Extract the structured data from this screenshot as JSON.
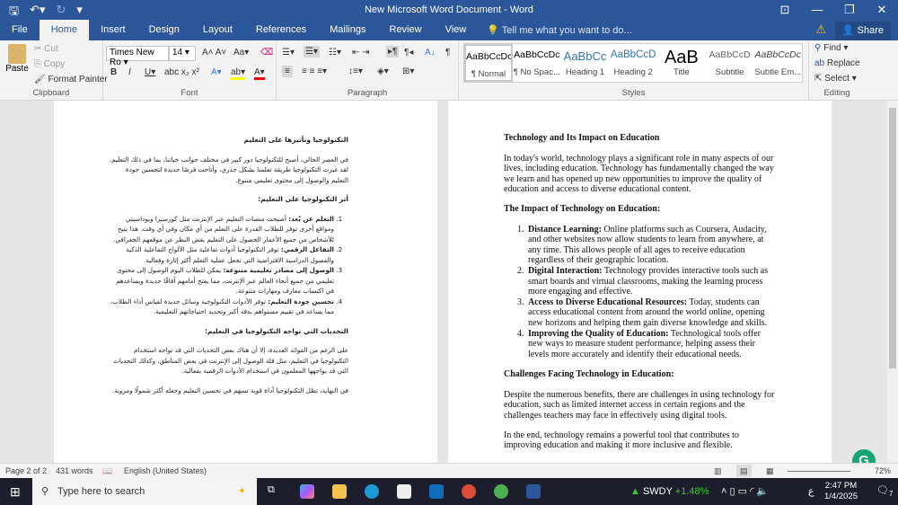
{
  "title": "New Microsoft Word Document - Word",
  "tabs": [
    "File",
    "Home",
    "Insert",
    "Design",
    "Layout",
    "References",
    "Mailings",
    "Review",
    "View"
  ],
  "tell_me": "Tell me what you want to do...",
  "share": "Share",
  "clipboard": {
    "paste": "Paste",
    "cut": "Cut",
    "copy": "Copy",
    "format_painter": "Format Painter",
    "label": "Clipboard"
  },
  "font": {
    "name": "Times New Ro",
    "size": "14",
    "label": "Font"
  },
  "paragraph": {
    "label": "Paragraph"
  },
  "styles": {
    "label": "Styles",
    "items": [
      {
        "preview": "AaBbCcDc",
        "name": "¶ Normal"
      },
      {
        "preview": "AaBbCcDc",
        "name": "¶ No Spac..."
      },
      {
        "preview": "AaBbCc",
        "name": "Heading 1"
      },
      {
        "preview": "AaBbCcD",
        "name": "Heading 2"
      },
      {
        "preview": "AaB",
        "name": "Title"
      },
      {
        "preview": "AaBbCcD",
        "name": "Subtitle"
      },
      {
        "preview": "AaBbCcDc",
        "name": "Subtle Em..."
      }
    ]
  },
  "editing": {
    "find": "Find",
    "replace": "Replace",
    "select": "Select",
    "label": "Editing"
  },
  "arabic": {
    "title": "التكنولوجيا وتأثيرها على التعليم",
    "intro": "في العصر الحالي، أصبح للتكنولوجيا دور كبير في مختلف جوانب حياتنا، بما في ذلك التعليم. لقد غيرت التكنولوجيا طريقة تعلمنا بشكل جذري، وأتاحت فرصًا جديدة لتحسين جودة التعليم والوصول إلى محتوى تعليمي متنوع.",
    "impact_heading": "أثر التكنولوجيا على التعليم:",
    "items": [
      {
        "b": "التعلم عن بُعد:",
        "t": " أصبحت منصات التعليم عبر الإنترنت مثل كورسيرا ويوداسيتي ومواقع أخرى توفر للطلاب القدرة على التعلم من أي مكان وفي أي وقت. هذا يتيح للأشخاص من جميع الأعمار الحصول على التعليم بغض النظر عن موقعهم الجغرافي."
      },
      {
        "b": "التفاعل الرقمي:",
        "t": " توفر التكنولوجيا أدوات تفاعلية مثل الألواح التفاعلية الذكية والفصول الدراسية الافتراضية التي تجعل عملية التعلم أكثر إثارة وفعالية."
      },
      {
        "b": "الوصول إلى مصادر تعليمية متنوعة:",
        "t": " يمكن للطلاب اليوم الوصول إلى محتوى تعليمي من جميع أنحاء العالم عبر الإنترنت، مما يفتح أمامهم آفاقًا جديدة ويساعدهم في اكتساب معارف ومهارات متنوعة."
      },
      {
        "b": "تحسين جودة التعليم:",
        "t": " توفر الأدوات التكنولوجية وسائل جديدة لقياس أداء الطلاب، مما يساعد في تقييم مستواهم بدقة أكبر وتحديد احتياجاتهم التعليمية."
      }
    ],
    "challenges_heading": "التحديات التي تواجه التكنولوجيا في التعليم:",
    "challenges": "على الرغم من الفوائد العديدة، إلا أن هناك بعض التحديات التي قد تواجه استخدام التكنولوجيا في التعليم، مثل قلة الوصول إلى الإنترنت في بعض المناطق، وكذلك التحديات التي قد يواجهها المعلمون في استخدام الأدوات الرقمية بفعالية.",
    "conclusion": "في النهاية، تظل التكنولوجيا أداة قوية تسهم في تحسين التعليم وجعله أكثر شمولًا ومرونة."
  },
  "english": {
    "title": "Technology and Its Impact on Education",
    "intro": "In today's world, technology plays a significant role in many aspects of our lives, including education. Technology has fundamentally changed the way we learn and has opened up new opportunities to improve the quality of education and access to diverse educational content.",
    "impact_heading": "The Impact of Technology on Education:",
    "items": [
      {
        "b": "Distance Learning:",
        "t": " Online platforms such as Coursera, Audacity, and other websites now allow students to learn from anywhere, at any time. This allows people of all ages to receive education regardless of their geographic location."
      },
      {
        "b": "Digital Interaction:",
        "t": " Technology provides interactive tools such as smart boards and virtual classrooms, making the learning process more engaging and effective."
      },
      {
        "b": "Access to Diverse Educational Resources:",
        "t": " Today, students can access educational content from around the world online, opening new horizons and helping them gain diverse knowledge and skills."
      },
      {
        "b": "Improving the Quality of Education:",
        "t": " Technological tools offer new ways to measure student performance, helping assess their levels more accurately and identify their educational needs."
      }
    ],
    "challenges_heading": "Challenges Facing Technology in Education:",
    "challenges": "Despite the numerous benefits, there are challenges in using technology for education, such as limited internet access in certain regions and the challenges teachers may face in effectively using digital tools.",
    "conclusion": "In the end, technology remains a powerful tool that contributes to improving education and making it more inclusive and flexible."
  },
  "status": {
    "page": "Page 2 of 2",
    "words": "431 words",
    "language": "English (United States)",
    "zoom": "72%"
  },
  "taskbar": {
    "search": "Type here to search",
    "stock_name": "SWDY",
    "stock_change": "+1.48%",
    "time": "2:47 PM",
    "date": "1/4/2025",
    "lang": "ع",
    "notif": "7"
  }
}
